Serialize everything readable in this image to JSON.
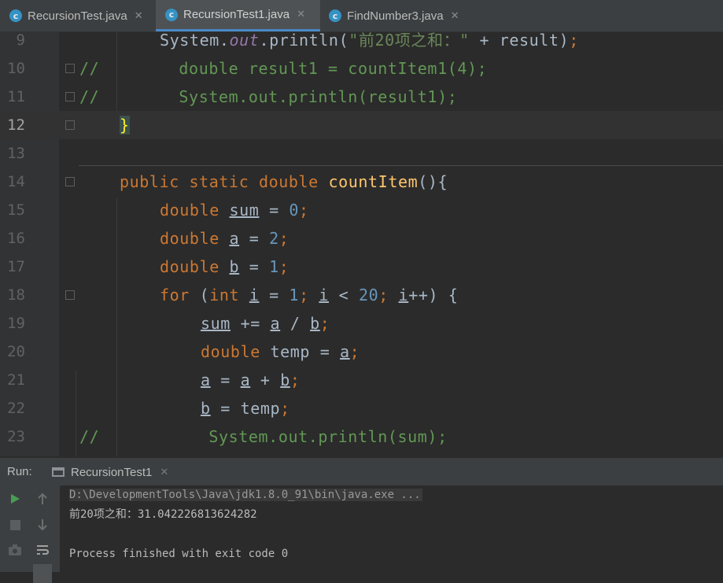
{
  "tabs": [
    {
      "label": "RecursionTest.java",
      "icon": "java-class-icon",
      "active": false
    },
    {
      "label": "RecursionTest1.java",
      "icon": "java-class-icon",
      "active": true
    },
    {
      "label": "FindNumber3.java",
      "icon": "java-class-icon",
      "active": false
    }
  ],
  "editor": {
    "current_line": 12,
    "lines": [
      {
        "n": "9"
      },
      {
        "n": "10"
      },
      {
        "n": "11"
      },
      {
        "n": "12"
      },
      {
        "n": "13"
      },
      {
        "n": "14"
      },
      {
        "n": "15"
      },
      {
        "n": "16"
      },
      {
        "n": "17"
      },
      {
        "n": "18"
      },
      {
        "n": "19"
      },
      {
        "n": "20"
      },
      {
        "n": "21"
      },
      {
        "n": "22"
      },
      {
        "n": "23"
      }
    ],
    "code": {
      "l9": {
        "sys": "System.",
        "out": "out",
        ".println(": ".println(",
        "str": "\"前20项之和：\"",
        "rest": " + result)",
        "semi": ";"
      },
      "l10": {
        "cm": "//        double result1 = countItem1(4);"
      },
      "l11": {
        "cm": "//        System.out.println(result1);"
      },
      "l12": {
        "brace": "}"
      },
      "l14": {
        "kw": "public static double ",
        "fn": "countItem",
        "rest": "(){"
      },
      "l15": {
        "kw": "double ",
        "var": "sum",
        "eq": " = ",
        "num": "0",
        "semi": ";"
      },
      "l16": {
        "kw": "double ",
        "var": "a",
        "eq": " = ",
        "num": "2",
        "semi": ";"
      },
      "l17": {
        "kw": "double ",
        "var": "b",
        "eq": " = ",
        "num": "1",
        "semi": ";"
      },
      "l18": {
        "kw1": "for ",
        "p1": "(",
        "kw2": "int ",
        "i1": "i",
        "eq": " = ",
        "n1": "1",
        "s1": "; ",
        "i2": "i",
        "lt": " < ",
        "n2": "20",
        "s2": "; ",
        "i3": "i",
        "end": "++) {"
      },
      "l19": {
        "v1": "sum",
        "op": " += ",
        "v2": "a",
        "div": " / ",
        "v3": "b",
        "semi": ";"
      },
      "l20": {
        "kw": "double ",
        "t": "temp = ",
        "v": "a",
        "semi": ";"
      },
      "l21": {
        "v1": "a",
        "eq": " = ",
        "v2": "a",
        "plus": " + ",
        "v3": "b",
        "semi": ";"
      },
      "l22": {
        "v1": "b",
        "eq": " = temp",
        "semi": ";"
      },
      "l23": {
        "cm": "//           System.out.println(sum);"
      }
    }
  },
  "run": {
    "label": "Run:",
    "tab": "RecursionTest1",
    "console": [
      "D:\\DevelopmentTools\\Java\\jdk1.8.0_91\\bin\\java.exe ...",
      "前20项之和：31.042226813624282",
      "",
      "Process finished with exit code 0"
    ]
  },
  "colors": {
    "keyword": "#cc7832",
    "number": "#6897bb",
    "string": "#6a8759",
    "function": "#ffc66d",
    "comment": "#629755",
    "field": "#9876aa",
    "accent": "#4a88c7"
  }
}
